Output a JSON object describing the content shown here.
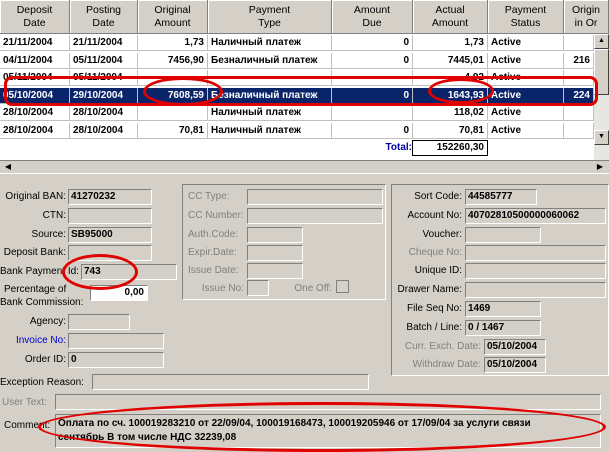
{
  "grid": {
    "headers": [
      {
        "label": "Deposit\nDate"
      },
      {
        "label": "Posting\nDate"
      },
      {
        "label": "Original\nAmount"
      },
      {
        "label": "Payment\nType"
      },
      {
        "label": "Amount\nDue"
      },
      {
        "label": "Actual\nAmount"
      },
      {
        "label": "Payment\nStatus"
      },
      {
        "label": "Origin\nin Or"
      }
    ],
    "rows": [
      {
        "deposit": "21/11/2004",
        "posting": "21/11/2004",
        "original": "1,73",
        "type": "Наличный платеж",
        "due": "0",
        "actual": "1,73",
        "status": "Active",
        "origin": ""
      },
      {
        "deposit": "04/11/2004",
        "posting": "05/11/2004",
        "original": "7456,90",
        "type": "Безналичный платеж",
        "due": "0",
        "actual": "7445,01",
        "status": "Active",
        "origin": "216"
      },
      {
        "deposit": "05/11/2004",
        "posting": "05/11/2004",
        "original": "",
        "type": "",
        "due": "",
        "actual": "4,92",
        "status": "Active",
        "origin": ""
      },
      {
        "deposit": "05/10/2004",
        "posting": "29/10/2004",
        "original": "7608,59",
        "type": "Безналичный платеж",
        "due": "0",
        "actual": "1643,93",
        "status": "Active",
        "origin": "224"
      },
      {
        "deposit": "28/10/2004",
        "posting": "28/10/2004",
        "original": "",
        "type": "Наличный платеж",
        "due": "",
        "actual": "118,02",
        "status": "Active",
        "origin": ""
      },
      {
        "deposit": "28/10/2004",
        "posting": "28/10/2004",
        "original": "70,81",
        "type": "Наличный платеж",
        "due": "0",
        "actual": "70,81",
        "status": "Active",
        "origin": ""
      }
    ],
    "selected_index": 3,
    "total_label": "Total:",
    "total_value": "152260,30"
  },
  "form": {
    "left": {
      "original_ban_label": "Original BAN:",
      "original_ban": "41270232",
      "ctn_label": "CTN:",
      "ctn": "",
      "source_label": "Source:",
      "source": "SB95000",
      "deposit_bank_label": "Deposit Bank:",
      "deposit_bank": "",
      "bank_payment_id_label": "Bank Payment Id:",
      "bank_payment_id": "743",
      "pct_commission_label_1": "Percentage of",
      "pct_commission_label_2": "Bank Commission:",
      "pct_commission": "0,00",
      "agency_label": "Agency:",
      "agency": "",
      "invoice_no_label": "Invoice No:",
      "invoice_no": "",
      "order_id_label": "Order ID:",
      "order_id": "0"
    },
    "middle": {
      "cc_type_label": "CC Type:",
      "cc_number_label": "CC Number:",
      "auth_code_label": "Auth.Code:",
      "expir_date_label": "Expir.Date:",
      "issue_date_label": "Issue Date:",
      "issue_no_label": "Issue No:",
      "one_off_label": "One Off:"
    },
    "right": {
      "sort_code_label": "Sort Code:",
      "sort_code": "44585777",
      "account_no_label": "Account No:",
      "account_no": "40702810500000060062",
      "voucher_label": "Voucher:",
      "voucher": "",
      "cheque_no_label": "Cheque No:",
      "cheque_no": "",
      "unique_id_label": "Unique ID:",
      "unique_id": "",
      "drawer_name_label": "Drawer Name:",
      "drawer_name": "",
      "file_seq_label": "File Seq No:",
      "file_seq": "1469",
      "batch_line_label": "Batch / Line:",
      "batch_line": "0 / 1467",
      "curr_exch_date_label": "Curr. Exch. Date:",
      "curr_exch_date": "05/10/2004",
      "withdraw_date_label": "Withdraw Date:",
      "withdraw_date": "05/10/2004"
    },
    "bottom": {
      "exception_reason_label": "Exception Reason:",
      "exception_reason": "",
      "user_text_label": "User Text:",
      "user_text": "",
      "comment_label": "Comment:",
      "comment_line1": "Оплата по сч. 100019283210 от 22/09/04, 100019168473, 100019205946 от 17/09/04 за услуги связи",
      "comment_line2": "сентябрь В том числе НДС 32239,08"
    }
  },
  "colors": {
    "selection": "#0a246a",
    "annotation": "#e00000",
    "window": "#d4d0c8"
  }
}
